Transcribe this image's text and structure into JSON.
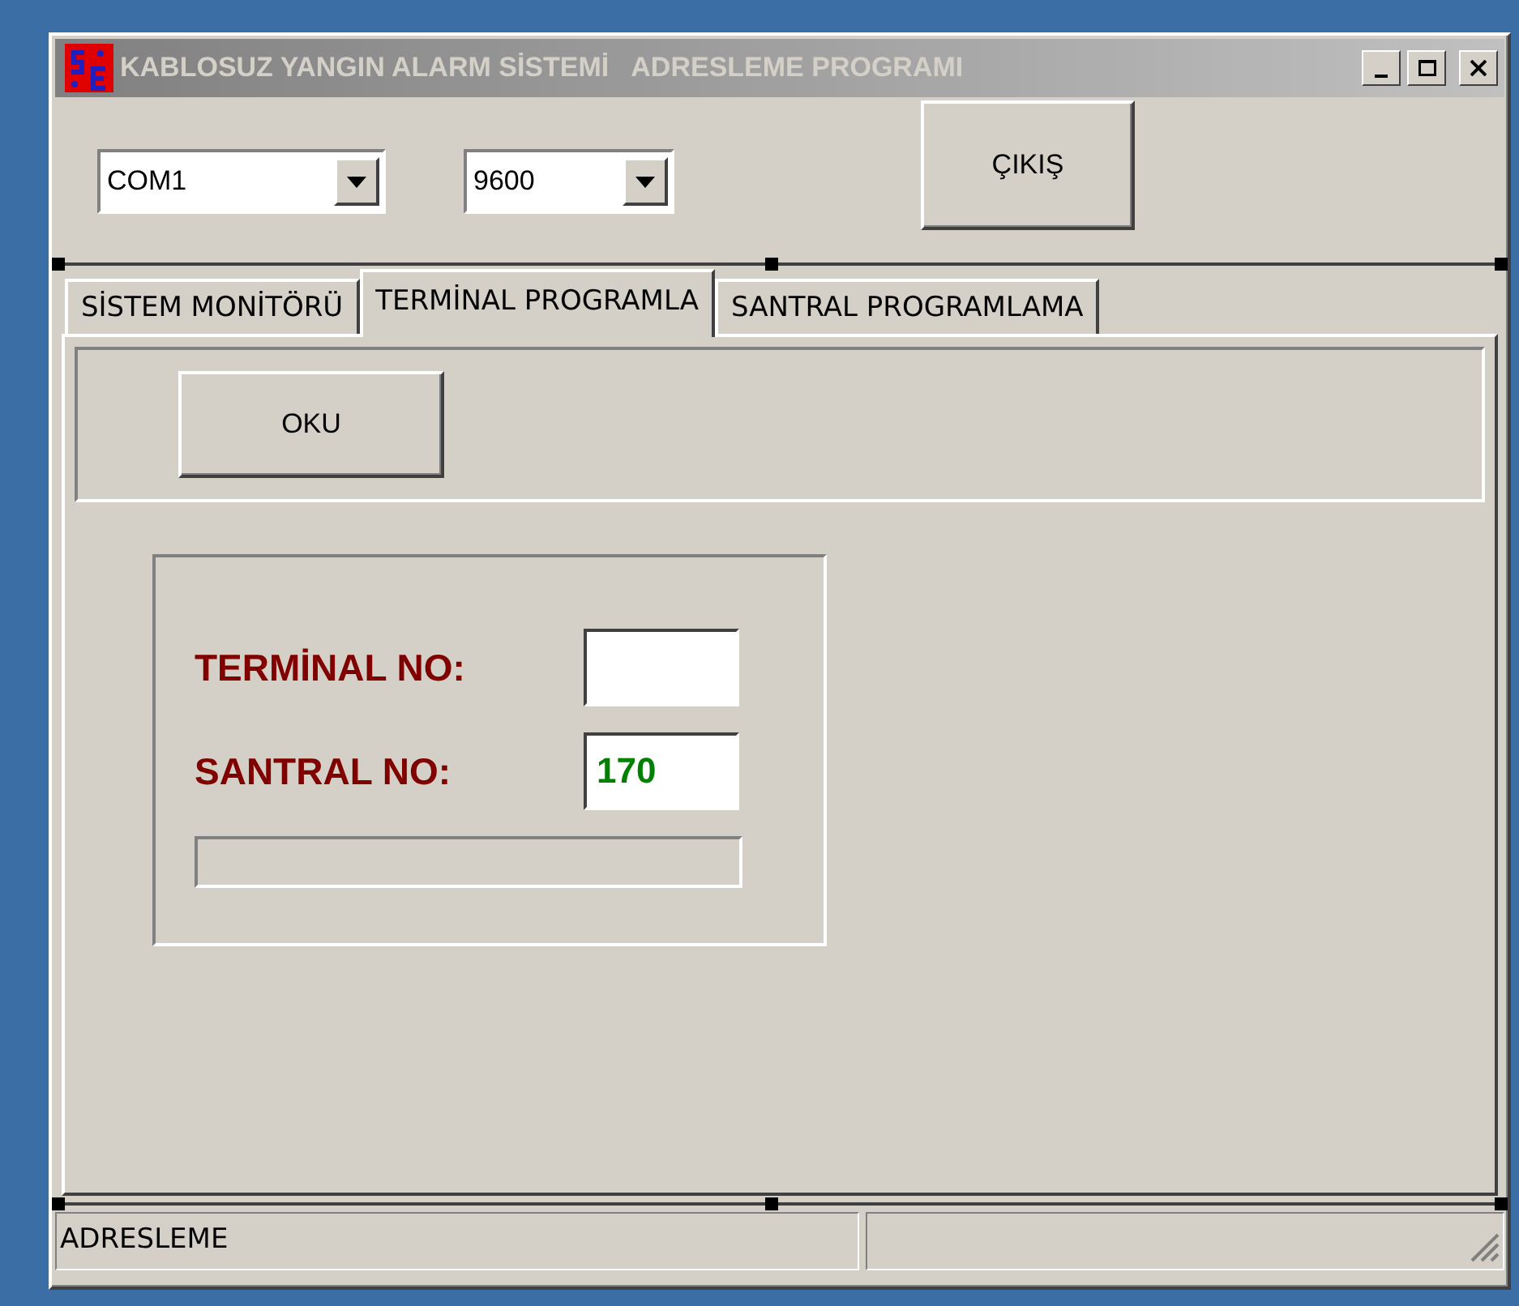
{
  "window": {
    "title": "KABLOSUZ YANGIN ALARM SİSTEMİ   ADRESLEME PROGRAMI",
    "active": false
  },
  "toolbar": {
    "port": {
      "value": "COM1"
    },
    "baud": {
      "value": "9600"
    },
    "exit_button": "ÇIKIŞ"
  },
  "tabs": [
    {
      "label": "SİSTEM MONİTÖRÜ",
      "selected": false
    },
    {
      "label": "TERMİNAL PROGRAMLA",
      "selected": true
    },
    {
      "label": "SANTRAL PROGRAMLAMA",
      "selected": false
    }
  ],
  "read_button": "OKU",
  "fields": [
    {
      "label": "TERMİNAL NO:"
    },
    {
      "label": "SANTRAL NO:",
      "value": "170"
    }
  ],
  "status_bar": [
    "ADRESLEME"
  ]
}
